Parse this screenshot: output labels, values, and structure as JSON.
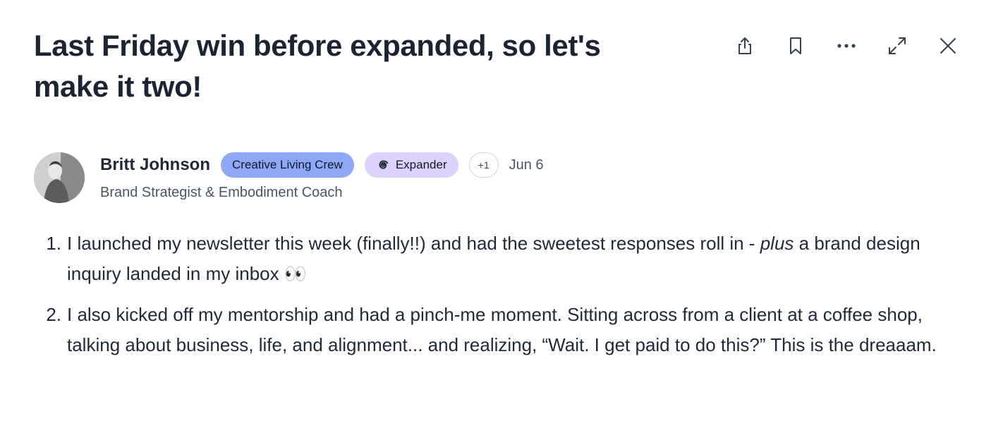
{
  "post": {
    "title": "Last Friday win before expanded, so let's make it two!",
    "author": {
      "name": "Britt Johnson",
      "role": "Brand Strategist & Embodiment Coach",
      "badges": {
        "crew": "Creative Living Crew",
        "expander": "Expander",
        "more": "+1"
      },
      "date": "Jun 6"
    },
    "items": [
      {
        "number": "1.",
        "before": "I launched my newsletter this week (finally!!) and had the sweetest responses roll in - ",
        "emphasis": "plus",
        "after": " a brand design inquiry landed in my inbox 👀"
      },
      {
        "number": "2.",
        "before": "I also kicked off my mentorship and had a pinch-me moment. Sitting across from a client at a coffee shop, talking about business, life, and alignment... and realizing, “Wait. I get paid to do this?” This is the dreaaam.",
        "emphasis": "",
        "after": ""
      }
    ]
  },
  "toolbar": {
    "icons": [
      "share-icon",
      "bookmark-icon",
      "more-icon",
      "expand-icon",
      "close-icon"
    ]
  },
  "colors": {
    "crew_badge": "#8ea8f5",
    "expander_badge": "#ddd2fb",
    "title": "#1c2434"
  }
}
